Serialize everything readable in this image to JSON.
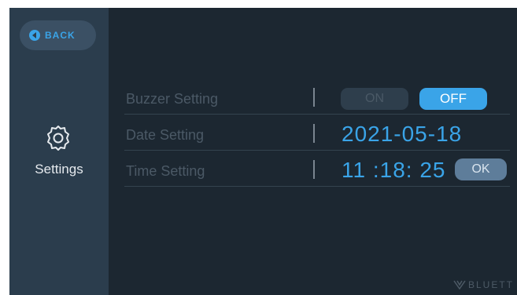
{
  "sidebar": {
    "back_label": "BACK",
    "settings_label": "Settings",
    "icons": {
      "back": "back-arrow-icon",
      "settings": "gear-icon"
    }
  },
  "settings": {
    "buzzer": {
      "label": "Buzzer Setting",
      "on_label": "ON",
      "off_label": "OFF",
      "selected": "OFF"
    },
    "date": {
      "label": "Date Setting",
      "value": "2021-05-18"
    },
    "time": {
      "label": "Time Setting",
      "value": "11 :18: 25",
      "ok_label": "OK"
    }
  },
  "brand": {
    "name": "BLUETT",
    "icon": "bluetti-logo-icon"
  },
  "colors": {
    "accent": "#3aa4e8",
    "background": "#1c2731",
    "sidebar": "#2b3d4d",
    "muted_text": "#4b5966"
  }
}
